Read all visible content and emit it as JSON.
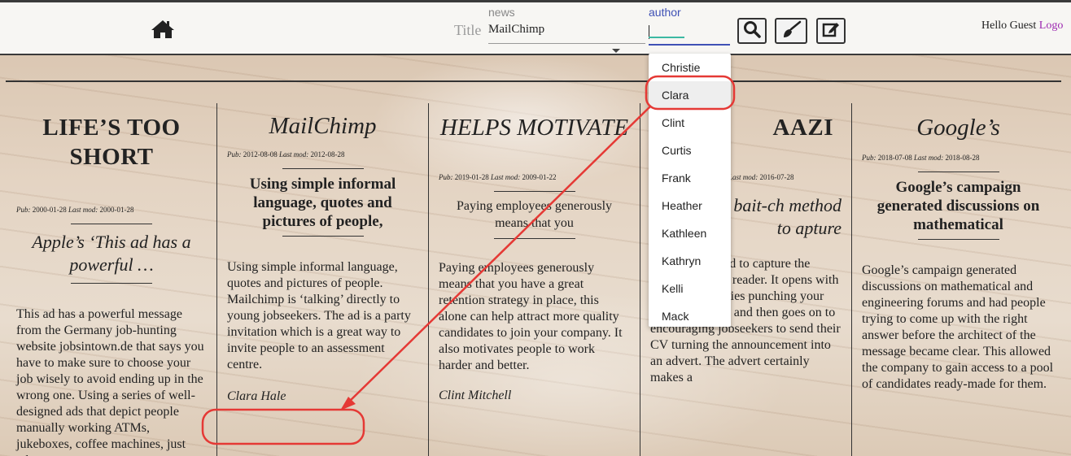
{
  "header": {
    "title_label": "Title",
    "news_label": "news",
    "news_value": "MailChimp",
    "author_label": "author",
    "author_value": "",
    "greeting_prefix": "Hello Guest",
    "logout_label": "Logo"
  },
  "author_options": [
    "Christie",
    "Clara",
    "Clint",
    "Curtis",
    "Frank",
    "Heather",
    "Kathleen",
    "Kathryn",
    "Kelli",
    "Mack"
  ],
  "articles": [
    {
      "headline": "LIFE’S TOO SHORT",
      "pub": "Pub:",
      "pub_date": "2000-01-28",
      "mod": "Last mod:",
      "mod_date": "2000-01-28",
      "subhead": "Apple’s ‘This ad has a powerful …",
      "body": "This ad has a powerful message from the Germany job-hunting website jobsintown.de that says you have to make sure to choose your job wisely to avoid ending up in the wrong one. Using a series of well-designed ads that depict people manually working ATMs, jukeboxes, coffee machines, just what",
      "byline": ""
    },
    {
      "headline": "MailChimp",
      "pub": "Pub:",
      "pub_date": "2012-08-08",
      "mod": "Last mod:",
      "mod_date": "2012-08-28",
      "subhead": "Using simple informal language, quotes and pictures of people,",
      "body": "Using simple informal language, quotes and pictures of people. Mailchimp is ‘talking’ directly to young jobseekers. The ad is a party invitation which is a great way to invite people to an assessment centre.",
      "byline": "Clara Hale"
    },
    {
      "headline": "HELPS MOTIVATE",
      "pub": "Pub:",
      "pub_date": "2019-01-28",
      "mod": "Last mod:",
      "mod_date": "2009-01-22",
      "subhead": "Paying employees generously means that you",
      "body": "Paying employees generously means that you have a great retention strategy in place, this alone can help attract more quality candidates to join your company. It also motivates people to work harder and better.",
      "byline": "Clint Mitchell"
    },
    {
      "headline": "AAZI",
      "pub": "Pub:",
      "pub_date": "",
      "mod": "Last mod:",
      "mod_date": "2016-07-28",
      "subhead": "s the old bait-ch method to apture",
      "body": "e old bait-and- d to capture the attention of the reader. It opens with ‘In most countries punching your boss is a crime’ and then goes on to encouraging jobseekers to send their CV turning the announcement into an advert. The advert certainly makes a",
      "byline": ""
    },
    {
      "headline": "Google’s",
      "pub": "Pub:",
      "pub_date": "2018-07-08",
      "mod": "Last mod:",
      "mod_date": "2018-08-28",
      "subhead": "Google’s campaign generated discussions on mathematical",
      "body": "Google’s campaign generated discussions on mathematical and engineering forums and had people trying to come up with the right answer before the architect of the message became clear. This allowed the company to gain access to a pool of candidates ready-made for them.",
      "byline": ""
    }
  ],
  "colors": {
    "annotation": "#e53935",
    "author_accent": "#3f51b5",
    "logout": "#9c27b0"
  }
}
